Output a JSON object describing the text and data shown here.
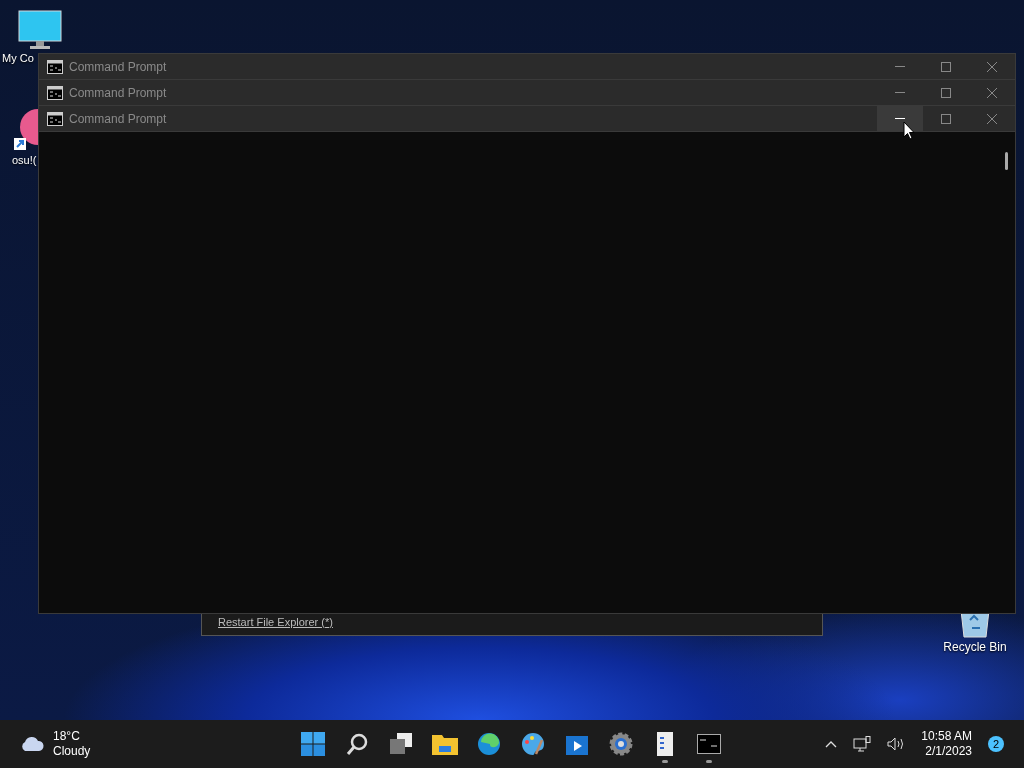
{
  "desktop_icons": [
    {
      "kind": "monitor",
      "label": "My Co"
    },
    {
      "kind": "app",
      "label": "osu!("
    },
    {
      "kind": "bin",
      "label": "Recycle Bin"
    }
  ],
  "background_panel": {
    "link": "Restart File Explorer (*)"
  },
  "windows": [
    {
      "title": "Command Prompt",
      "minimize_hovered": false
    },
    {
      "title": "Command Prompt",
      "minimize_hovered": false
    },
    {
      "title": "Command Prompt",
      "minimize_hovered": true
    }
  ],
  "taskbar": {
    "weather": {
      "temperature": "18°C",
      "condition": "Cloudy"
    },
    "apps": [
      {
        "kind": "start",
        "running": false
      },
      {
        "kind": "search",
        "running": false
      },
      {
        "kind": "taskview",
        "running": false
      },
      {
        "kind": "folder",
        "running": false
      },
      {
        "kind": "edge",
        "running": false
      },
      {
        "kind": "paint",
        "running": false
      },
      {
        "kind": "video",
        "running": false
      },
      {
        "kind": "settings",
        "running": false
      },
      {
        "kind": "notes",
        "running": true
      },
      {
        "kind": "terminal",
        "running": true
      }
    ],
    "tray": {
      "time": "10:58 AM",
      "date": "2/1/2023",
      "notifications": "2"
    }
  }
}
